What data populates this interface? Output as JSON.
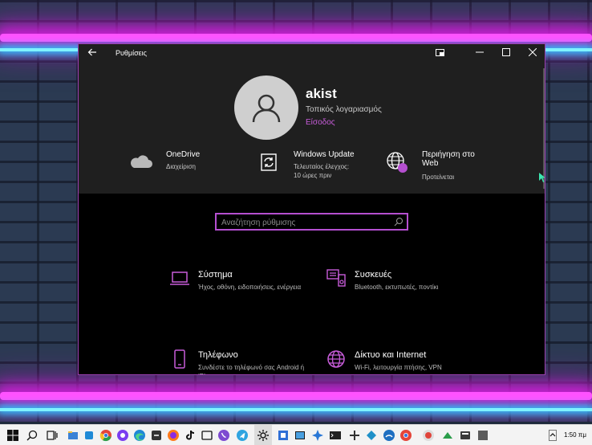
{
  "window": {
    "title": "Ρυθμίσεις",
    "accent": "#c75cd9"
  },
  "profile": {
    "name": "akist",
    "account_type": "Τοπικός λογαριασμός",
    "sign_in": "Είσοδος"
  },
  "quick_links": [
    {
      "title": "OneDrive",
      "subtitle": "Διαχείριση",
      "icon": "cloud-icon"
    },
    {
      "title": "Windows Update",
      "subtitle": "Τελευταίος έλεγχος:",
      "subtitle2": "10 ώρες πριν",
      "icon": "refresh-icon"
    },
    {
      "title": "Περιήγηση στο",
      "title2": "Web",
      "subtitle": "Προτείνεται",
      "icon": "globe-icon"
    }
  ],
  "search": {
    "placeholder": "Αναζήτηση ρύθμισης"
  },
  "categories": [
    {
      "title": "Σύστημα",
      "subtitle": "Ήχος, οθόνη, ειδοποιήσεις, ενέργεια",
      "icon": "laptop-icon"
    },
    {
      "title": "Συσκευές",
      "subtitle": "Bluetooth, εκτυπωτές, ποντίκι",
      "icon": "devices-icon"
    },
    {
      "title": "Τηλέφωνο",
      "subtitle": "Συνδέστε το τηλέφωνό σας Android ή iPhone",
      "icon": "phone-icon"
    },
    {
      "title": "Δίκτυο και Internet",
      "subtitle": "Wi-Fi, λειτουργία πτήσης, VPN",
      "icon": "globe-icon"
    }
  ],
  "taskbar": {
    "clock": "1:50 πμ"
  }
}
